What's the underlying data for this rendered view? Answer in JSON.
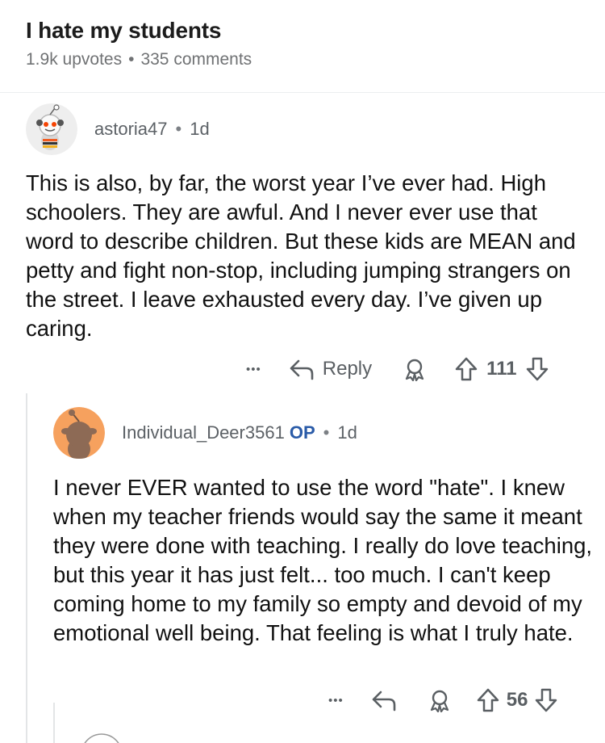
{
  "post": {
    "title": "I hate my students",
    "upvotes": "1.9k upvotes",
    "separator": "•",
    "comments": "335 comments"
  },
  "comments": [
    {
      "username": "astoria47",
      "separator": "•",
      "age": "1d",
      "body": "This is also, by far, the worst year I’ve ever had. High schoolers. They are awful. And I never ever use that word to describe children. But these kids are MEAN and petty and fight non-stop, including jumping strangers on the street. I leave exhausted every day. I’ve given up caring.",
      "more_label": "•••",
      "reply_label": "Reply",
      "score": "111"
    },
    {
      "username": "Individual_Deer3561",
      "op_badge": "OP",
      "separator": "•",
      "age": "1d",
      "body": "I never EVER wanted to use the word \"hate\". I knew when my teacher friends would say the same it meant they were done with teaching. I really do love teaching, but this year it has just felt... too much. I can't keep coming home to my family so empty and devoid of my emotional well being. That feeling is what I truly hate.",
      "more_label": "•••",
      "score": "56"
    }
  ],
  "colors": {
    "text": "#111111",
    "meta": "#707274",
    "op": "#2a5ba8",
    "icon": "#5a5f63",
    "thread": "#e3e5e7"
  },
  "icons": [
    "snoo-avatar-icon",
    "reply-arrow-icon",
    "award-icon",
    "upvote-arrow-icon",
    "downvote-arrow-icon",
    "more-icon"
  ]
}
